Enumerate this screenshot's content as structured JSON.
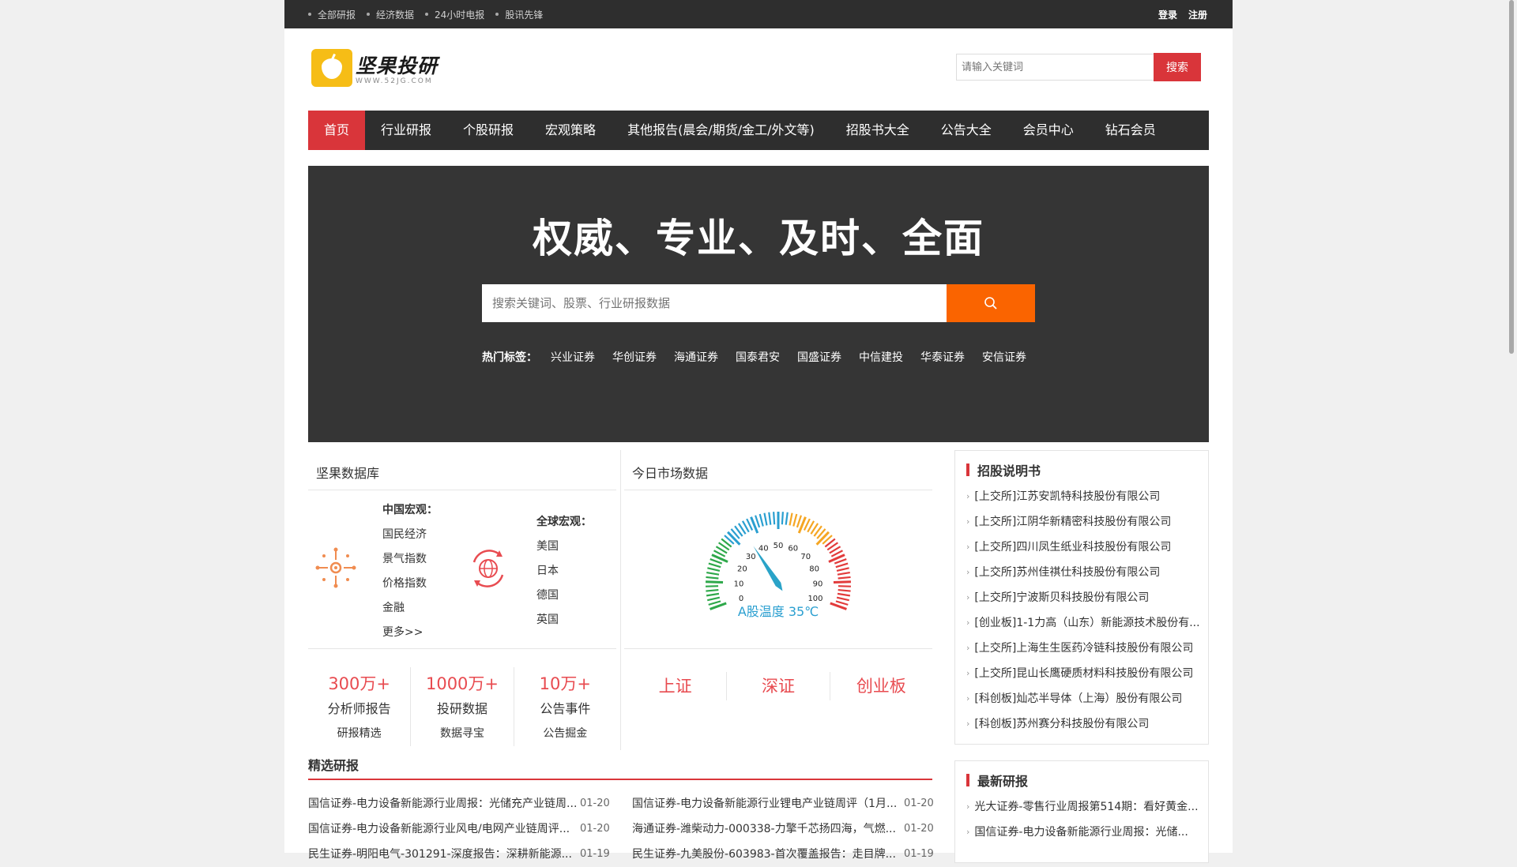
{
  "topbar": {
    "links": [
      "全部研报",
      "经济数据",
      "24小时电报",
      "股讯先锋"
    ],
    "login": "登录",
    "register": "注册"
  },
  "logo": {
    "main": "坚果投研",
    "sub": "WWW.52JG.COM"
  },
  "header_search": {
    "placeholder": "请输入关键词",
    "button": "搜索"
  },
  "nav": [
    "首页",
    "行业研报",
    "个股研报",
    "宏观策略",
    "其他报告(晨会/期货/金工/外文等)",
    "招股书大全",
    "公告大全",
    "会员中心",
    "钻石会员"
  ],
  "hero": {
    "title": "权威、专业、及时、全面",
    "search_placeholder": "搜索关键词、股票、行业研报数据",
    "hot_label": "热门标签：",
    "hot_tags": [
      "兴业证券",
      "华创证券",
      "海通证券",
      "国泰君安",
      "国盛证券",
      "中信建投",
      "华泰证券",
      "安信证券"
    ]
  },
  "database": {
    "title": "坚果数据库",
    "china": {
      "title": "中国宏观：",
      "items": [
        "国民经济",
        "景气指数",
        "价格指数",
        "金融",
        "更多>>"
      ]
    },
    "global": {
      "title": "全球宏观：",
      "items": [
        "美国",
        "日本",
        "德国",
        "英国"
      ]
    },
    "stats": [
      {
        "value": "300万+",
        "label": "分析师报告",
        "sub": "研报精选"
      },
      {
        "value": "1000万+",
        "label": "投研数据",
        "sub": "数据寻宝"
      },
      {
        "value": "10万+",
        "label": "公告事件",
        "sub": "公告掘金"
      }
    ]
  },
  "market": {
    "title": "今日市场数据",
    "gauge": {
      "label": "A股温度 35℃",
      "value": 35,
      "min": 0,
      "max": 100,
      "ticks": [
        "0",
        "10",
        "20",
        "30",
        "40",
        "50",
        "60",
        "70",
        "80",
        "90",
        "100"
      ]
    },
    "indices": [
      "上证",
      "深证",
      "创业板"
    ]
  },
  "prospectus": {
    "title": "招股说明书",
    "items": [
      "[上交所]江苏安凯特科技股份有限公司",
      "[上交所]江阴华新精密科技股份有限公司",
      "[上交所]四川凤生纸业科技股份有限公司",
      "[上交所]苏州佳祺仕科技股份有限公司",
      "[上交所]宁波斯贝科技股份有限公司",
      "[创业板]1-1力高（山东）新能源技术股份有...",
      "[上交所]上海生生医药冷链科技股份有限公司",
      "[上交所]昆山长鹰硬质材料科技股份有限公司",
      "[科创板]灿芯半导体（上海）股份有限公司",
      "[科创板]苏州赛分科技股份有限公司"
    ]
  },
  "latest": {
    "title": "最新研报",
    "items": [
      "光大证券-零售行业周报第514期：看好黄金...",
      "国信证券-电力设备新能源行业周报：光储..."
    ]
  },
  "selected": {
    "title": "精选研报",
    "rows": [
      {
        "title": "国信证券-电力设备新能源行业周报：光储充产业链周...",
        "date": "01-20"
      },
      {
        "title": "国信证券-电力设备新能源行业锂电产业链周评（1月...",
        "date": "01-20"
      },
      {
        "title": "国信证券-电力设备新能源行业风电/电网产业链周评...",
        "date": "01-20"
      },
      {
        "title": "海通证券-潍柴动力-000338-力擎千芯扬四海，气燃...",
        "date": "01-20"
      },
      {
        "title": "民生证券-明阳电气-301291-深度报告：深耕新能源...",
        "date": "01-19"
      },
      {
        "title": "民生证券-九美股份-603983-首次覆盖报告：走目牌...",
        "date": "01-19"
      }
    ]
  }
}
